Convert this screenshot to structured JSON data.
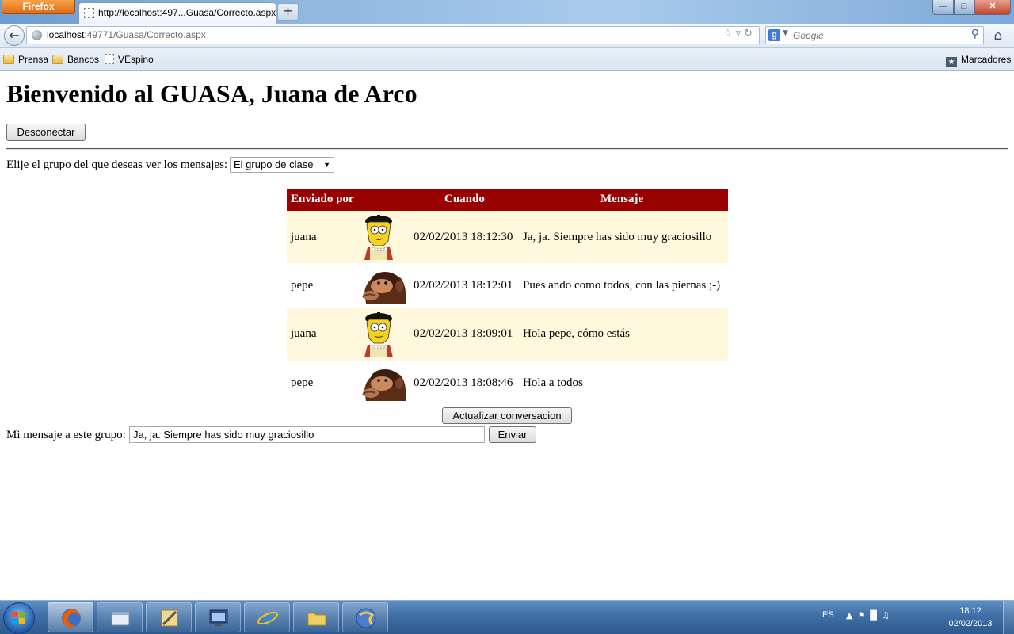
{
  "browser": {
    "menu_button": "Firefox",
    "tab_title": "http://localhost:497...Guasa/Correcto.aspx",
    "new_tab": "+",
    "url_host": "localhost",
    "url_rest": ":49771/Guasa/Correcto.aspx",
    "search_engine": "g",
    "search_placeholder": "Google",
    "bookmarks": [
      "Prensa",
      "Bancos",
      "VEspino"
    ],
    "bookmarks_menu": "Marcadores"
  },
  "page": {
    "title": "Bienvenido al GUASA, Juana de Arco",
    "disconnect_label": "Desconectar",
    "group_label": "Elije el grupo del que deseas ver los mensajes:",
    "group_selected": "El grupo de clase",
    "table": {
      "headers": {
        "sender": "Enviado por",
        "when": "Cuando",
        "message": "Mensaje"
      },
      "rows": [
        {
          "sender": "juana",
          "avatar": "lisa-avatar-icon",
          "when": "02/02/2013 18:12:30",
          "message": "Ja, ja. Siempre has sido muy graciosillo"
        },
        {
          "sender": "pepe",
          "avatar": "monkey-avatar-icon",
          "when": "02/02/2013 18:12:01",
          "message": "Pues ando como todos, con las piernas ;-)"
        },
        {
          "sender": "juana",
          "avatar": "lisa-avatar-icon",
          "when": "02/02/2013 18:09:01",
          "message": "Hola pepe, cómo estás"
        },
        {
          "sender": "pepe",
          "avatar": "monkey-avatar-icon",
          "when": "02/02/2013 18:08:46",
          "message": "Hola a todos"
        }
      ]
    },
    "refresh_label": "Actualizar conversacion",
    "my_message_label": "Mi mensaje a este grupo:",
    "my_message_value": "Ja, ja. Siempre has sido muy graciosillo",
    "send_label": "Enviar"
  },
  "taskbar": {
    "language": "ES",
    "time": "18:12",
    "date": "02/02/2013"
  },
  "colors": {
    "table_header": "#990000",
    "row_alt": "#fff8dc"
  }
}
